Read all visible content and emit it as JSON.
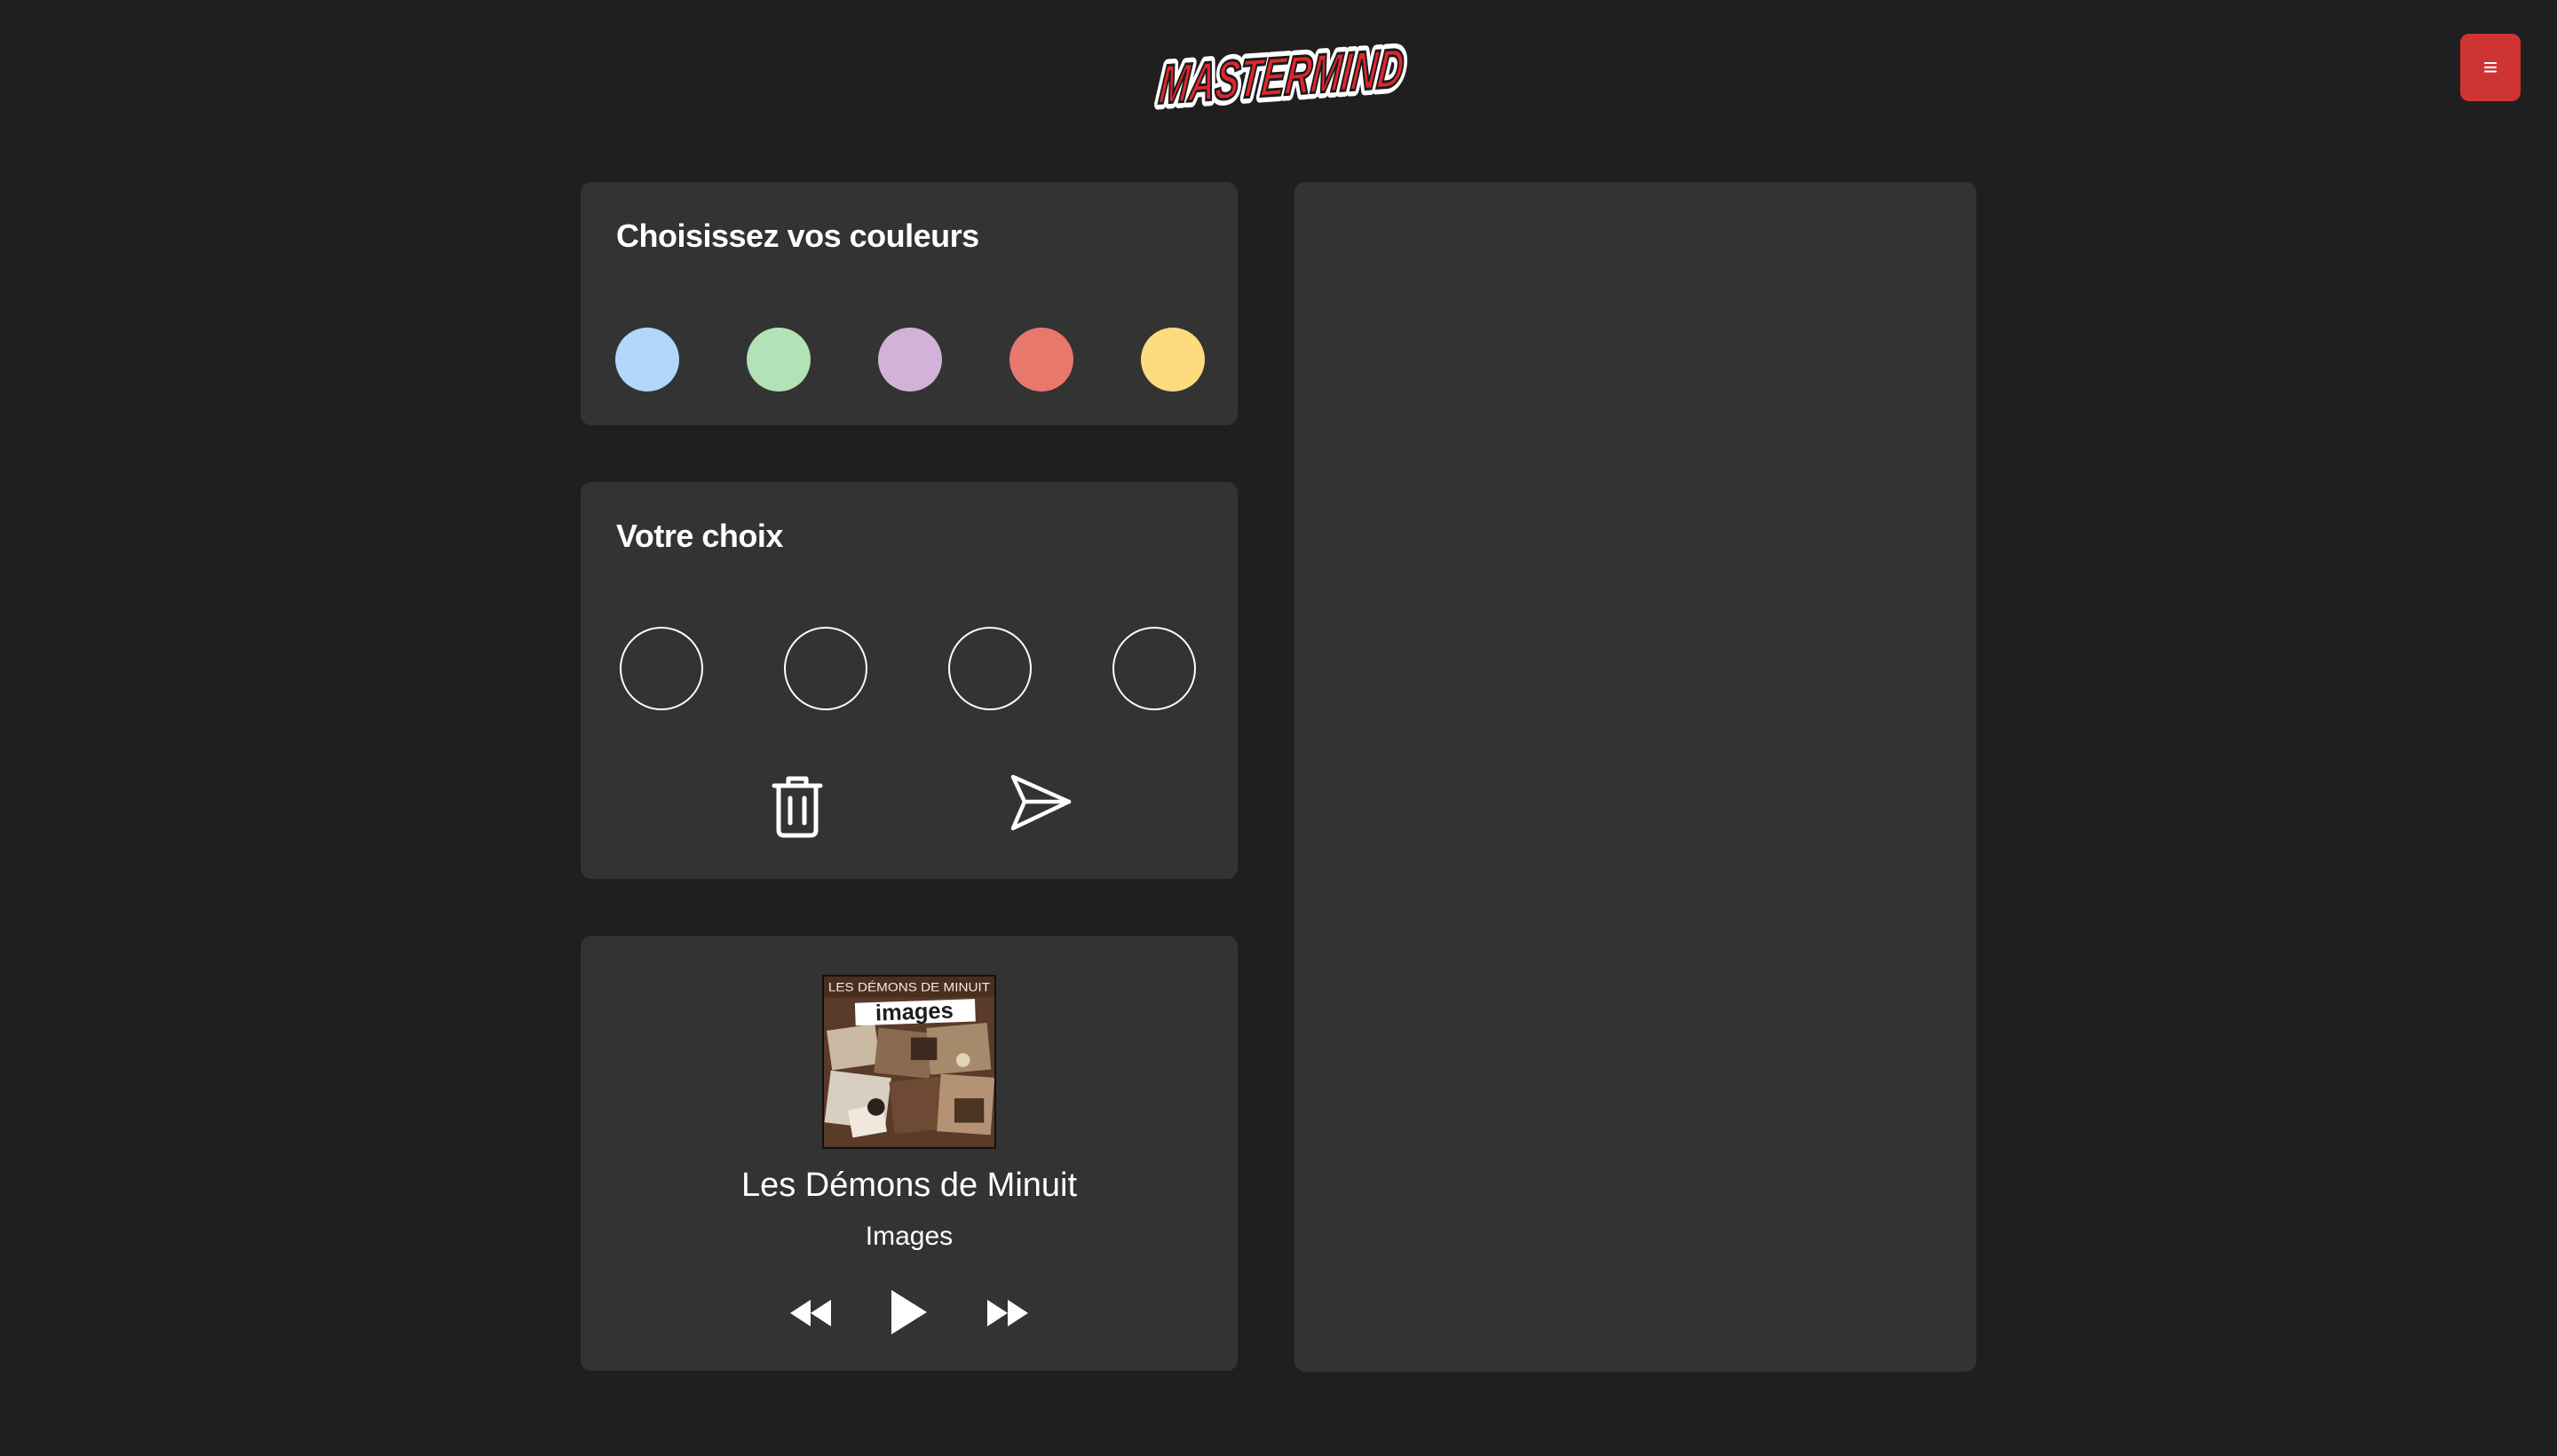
{
  "header": {
    "logo_text": "MASTERMIND",
    "menu_label": "≡"
  },
  "colors_panel": {
    "title": "Choisissez vos couleurs",
    "swatches": [
      {
        "name": "blue",
        "color": "#b3d6fb"
      },
      {
        "name": "green",
        "color": "#b2e3b7"
      },
      {
        "name": "purple",
        "color": "#d2b2d8"
      },
      {
        "name": "red",
        "color": "#e8786c"
      },
      {
        "name": "yellow",
        "color": "#fcdc7e"
      }
    ]
  },
  "choice_panel": {
    "title": "Votre choix",
    "slot_count": 4,
    "actions": {
      "clear_icon": "trash-icon",
      "submit_icon": "send-icon"
    }
  },
  "player": {
    "cover_text_top": "LES DÉMONS DE MINUIT",
    "cover_text_album": "images",
    "track_title": "Les Démons de Minuit",
    "album": "Images",
    "controls": [
      "rewind-icon",
      "play-icon",
      "forward-icon"
    ]
  },
  "theme": {
    "background": "#1f1f1f",
    "panel": "#333333",
    "accent": "#cf3434"
  }
}
